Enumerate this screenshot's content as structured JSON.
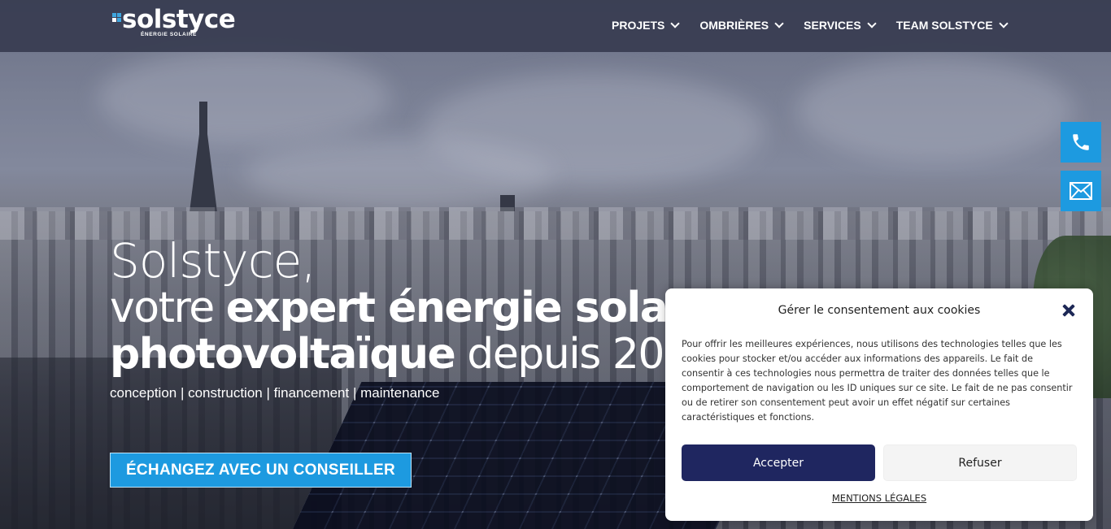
{
  "header": {
    "logo_name": "solstyce",
    "logo_tagline": "ÉNERGIE SOLAIRE",
    "nav": [
      {
        "label": "PROJETS"
      },
      {
        "label": "OMBRIÈRES"
      },
      {
        "label": "SERVICES"
      },
      {
        "label": "TEAM SOLSTYCE"
      }
    ]
  },
  "hero": {
    "line1": "Solstyce,",
    "line2_light": "votre ",
    "line2_bold": "expert énergie solaire",
    "line3_bold": "photovoltaïque",
    "line3_light": " depuis 2008",
    "tagline": "conception | construction | financement | maintenance",
    "cta_label": "ÉCHANGEZ AVEC UN CONSEILLER"
  },
  "side_contact": {
    "phone_icon": "phone-icon",
    "mail_icon": "mail-icon"
  },
  "cookie": {
    "title": "Gérer le consentement aux cookies",
    "body": "Pour offrir les meilleures expériences, nous utilisons des technologies telles que les cookies pour stocker et/ou accéder aux informations des appareils. Le fait de consentir à ces technologies nous permettra de traiter des données telles que le comportement de navigation ou les ID uniques sur ce site. Le fait de ne pas consentir ou de retirer son consentement peut avoir un effet négatif sur certaines caractéristiques et fonctions.",
    "accept_label": "Accepter",
    "refuse_label": "Refuser",
    "legal_label": "MENTIONS LÉGALES"
  },
  "colors": {
    "accent": "#1d9ae0",
    "accept_button": "#1f2660",
    "header_bg": "#373c50"
  }
}
